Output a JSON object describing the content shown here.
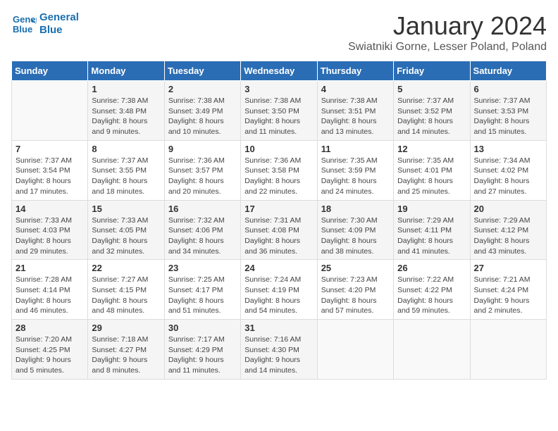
{
  "logo": {
    "line1": "General",
    "line2": "Blue"
  },
  "title": "January 2024",
  "location": "Swiatniki Gorne, Lesser Poland, Poland",
  "days_of_week": [
    "Sunday",
    "Monday",
    "Tuesday",
    "Wednesday",
    "Thursday",
    "Friday",
    "Saturday"
  ],
  "weeks": [
    [
      {
        "day": "",
        "info": ""
      },
      {
        "day": "1",
        "info": "Sunrise: 7:38 AM\nSunset: 3:48 PM\nDaylight: 8 hours\nand 9 minutes."
      },
      {
        "day": "2",
        "info": "Sunrise: 7:38 AM\nSunset: 3:49 PM\nDaylight: 8 hours\nand 10 minutes."
      },
      {
        "day": "3",
        "info": "Sunrise: 7:38 AM\nSunset: 3:50 PM\nDaylight: 8 hours\nand 11 minutes."
      },
      {
        "day": "4",
        "info": "Sunrise: 7:38 AM\nSunset: 3:51 PM\nDaylight: 8 hours\nand 13 minutes."
      },
      {
        "day": "5",
        "info": "Sunrise: 7:37 AM\nSunset: 3:52 PM\nDaylight: 8 hours\nand 14 minutes."
      },
      {
        "day": "6",
        "info": "Sunrise: 7:37 AM\nSunset: 3:53 PM\nDaylight: 8 hours\nand 15 minutes."
      }
    ],
    [
      {
        "day": "7",
        "info": "Sunrise: 7:37 AM\nSunset: 3:54 PM\nDaylight: 8 hours\nand 17 minutes."
      },
      {
        "day": "8",
        "info": "Sunrise: 7:37 AM\nSunset: 3:55 PM\nDaylight: 8 hours\nand 18 minutes."
      },
      {
        "day": "9",
        "info": "Sunrise: 7:36 AM\nSunset: 3:57 PM\nDaylight: 8 hours\nand 20 minutes."
      },
      {
        "day": "10",
        "info": "Sunrise: 7:36 AM\nSunset: 3:58 PM\nDaylight: 8 hours\nand 22 minutes."
      },
      {
        "day": "11",
        "info": "Sunrise: 7:35 AM\nSunset: 3:59 PM\nDaylight: 8 hours\nand 24 minutes."
      },
      {
        "day": "12",
        "info": "Sunrise: 7:35 AM\nSunset: 4:01 PM\nDaylight: 8 hours\nand 25 minutes."
      },
      {
        "day": "13",
        "info": "Sunrise: 7:34 AM\nSunset: 4:02 PM\nDaylight: 8 hours\nand 27 minutes."
      }
    ],
    [
      {
        "day": "14",
        "info": "Sunrise: 7:33 AM\nSunset: 4:03 PM\nDaylight: 8 hours\nand 29 minutes."
      },
      {
        "day": "15",
        "info": "Sunrise: 7:33 AM\nSunset: 4:05 PM\nDaylight: 8 hours\nand 32 minutes."
      },
      {
        "day": "16",
        "info": "Sunrise: 7:32 AM\nSunset: 4:06 PM\nDaylight: 8 hours\nand 34 minutes."
      },
      {
        "day": "17",
        "info": "Sunrise: 7:31 AM\nSunset: 4:08 PM\nDaylight: 8 hours\nand 36 minutes."
      },
      {
        "day": "18",
        "info": "Sunrise: 7:30 AM\nSunset: 4:09 PM\nDaylight: 8 hours\nand 38 minutes."
      },
      {
        "day": "19",
        "info": "Sunrise: 7:29 AM\nSunset: 4:11 PM\nDaylight: 8 hours\nand 41 minutes."
      },
      {
        "day": "20",
        "info": "Sunrise: 7:29 AM\nSunset: 4:12 PM\nDaylight: 8 hours\nand 43 minutes."
      }
    ],
    [
      {
        "day": "21",
        "info": "Sunrise: 7:28 AM\nSunset: 4:14 PM\nDaylight: 8 hours\nand 46 minutes."
      },
      {
        "day": "22",
        "info": "Sunrise: 7:27 AM\nSunset: 4:15 PM\nDaylight: 8 hours\nand 48 minutes."
      },
      {
        "day": "23",
        "info": "Sunrise: 7:25 AM\nSunset: 4:17 PM\nDaylight: 8 hours\nand 51 minutes."
      },
      {
        "day": "24",
        "info": "Sunrise: 7:24 AM\nSunset: 4:19 PM\nDaylight: 8 hours\nand 54 minutes."
      },
      {
        "day": "25",
        "info": "Sunrise: 7:23 AM\nSunset: 4:20 PM\nDaylight: 8 hours\nand 57 minutes."
      },
      {
        "day": "26",
        "info": "Sunrise: 7:22 AM\nSunset: 4:22 PM\nDaylight: 8 hours\nand 59 minutes."
      },
      {
        "day": "27",
        "info": "Sunrise: 7:21 AM\nSunset: 4:24 PM\nDaylight: 9 hours\nand 2 minutes."
      }
    ],
    [
      {
        "day": "28",
        "info": "Sunrise: 7:20 AM\nSunset: 4:25 PM\nDaylight: 9 hours\nand 5 minutes."
      },
      {
        "day": "29",
        "info": "Sunrise: 7:18 AM\nSunset: 4:27 PM\nDaylight: 9 hours\nand 8 minutes."
      },
      {
        "day": "30",
        "info": "Sunrise: 7:17 AM\nSunset: 4:29 PM\nDaylight: 9 hours\nand 11 minutes."
      },
      {
        "day": "31",
        "info": "Sunrise: 7:16 AM\nSunset: 4:30 PM\nDaylight: 9 hours\nand 14 minutes."
      },
      {
        "day": "",
        "info": ""
      },
      {
        "day": "",
        "info": ""
      },
      {
        "day": "",
        "info": ""
      }
    ]
  ]
}
